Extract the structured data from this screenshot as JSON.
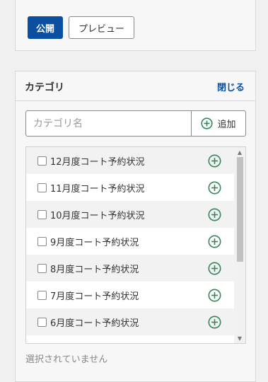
{
  "publish_panel": {
    "publish_label": "公開",
    "preview_label": "プレビュー"
  },
  "category_panel": {
    "title": "カテゴリ",
    "close_label": "閉じる",
    "search_placeholder": "カテゴリ名",
    "add_label": "追加",
    "items": [
      {
        "label": "12月度コート予約状況",
        "checked": false
      },
      {
        "label": "11月度コート予約状況",
        "checked": false
      },
      {
        "label": "10月度コート予約状況",
        "checked": false
      },
      {
        "label": "9月度コート予約状況",
        "checked": false
      },
      {
        "label": "8月度コート予約状況",
        "checked": false
      },
      {
        "label": "7月度コート予約状況",
        "checked": false
      },
      {
        "label": "6月度コート予約状況",
        "checked": false
      }
    ],
    "status_text": "選択されていません"
  },
  "colors": {
    "accent": "#0b4fa0",
    "add_icon": "#2e8b57"
  },
  "icons": {
    "add": "plus-circle-icon",
    "scroll_up": "triangle-up-icon",
    "scroll_down": "triangle-down-icon"
  }
}
